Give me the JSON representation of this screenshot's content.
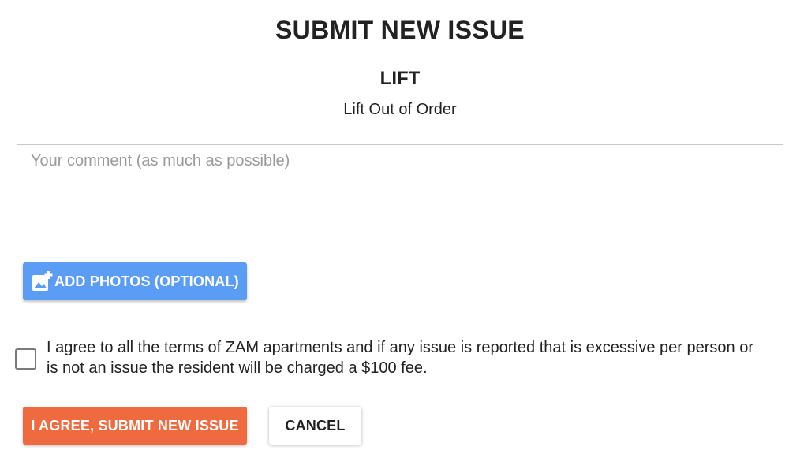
{
  "header": {
    "title": "SUBMIT NEW ISSUE",
    "category": "LIFT",
    "subcategory": "Lift Out of Order"
  },
  "comment": {
    "placeholder": "Your comment (as much as possible)",
    "value": ""
  },
  "photos": {
    "button_label": "ADD PHOTOS (OPTIONAL)",
    "icon": "add-photo-icon"
  },
  "agreement": {
    "checked": false,
    "text": "I agree to all the terms of ZAM apartments and if any issue is reported that is excessive per person or is not an issue the resident will be charged a $100 fee."
  },
  "actions": {
    "submit_label": "I AGREE, SUBMIT NEW ISSUE",
    "cancel_label": "CANCEL"
  },
  "colors": {
    "photo_button": "#5b9df5",
    "submit_button": "#ef6a3f",
    "text": "#222222"
  }
}
